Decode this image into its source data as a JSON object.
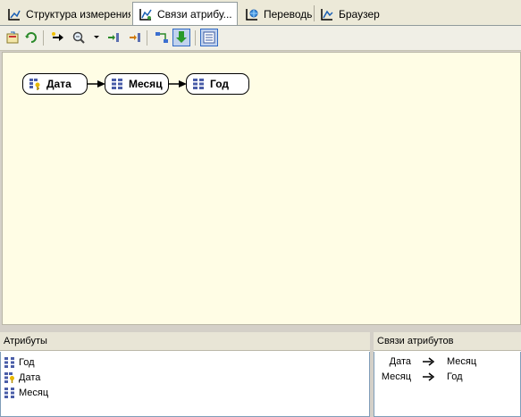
{
  "tabs": [
    {
      "label": "Структура измерения",
      "icon": "dimension-structure-icon"
    },
    {
      "label": "Связи атрибу...",
      "icon": "attribute-relationships-icon"
    },
    {
      "label": "Переводы",
      "icon": "translations-icon"
    },
    {
      "label": "Браузер",
      "icon": "browser-icon"
    }
  ],
  "toolbar": [
    "process-icon",
    "refresh-icon",
    "new-relationship-arrow-icon",
    "zoom-icon",
    "add-attribute-icon",
    "remove-attribute-icon",
    "arrange-shapes-icon",
    "expand-down-icon",
    "show-list-view-icon"
  ],
  "diagram": {
    "nodes": [
      "Дата",
      "Месяц",
      "Год"
    ],
    "node_icons": [
      "key-attribute-icon",
      "attribute-icon",
      "attribute-icon"
    ]
  },
  "attributes_panel": {
    "title": "Атрибуты",
    "items": [
      "Год",
      "Дата",
      "Месяц"
    ],
    "item_icons": [
      "attribute-icon",
      "key-attribute-icon",
      "attribute-icon"
    ]
  },
  "relationships_panel": {
    "title": "Связи атрибутов",
    "rows": [
      {
        "from": "Дата",
        "to": "Месяц"
      },
      {
        "from": "Месяц",
        "to": "Год"
      }
    ]
  },
  "colors": {
    "canvas_bg": "#fffde5",
    "toolbar_pressed": "#c1d2ee",
    "panel_header": "#e8e5d6"
  }
}
